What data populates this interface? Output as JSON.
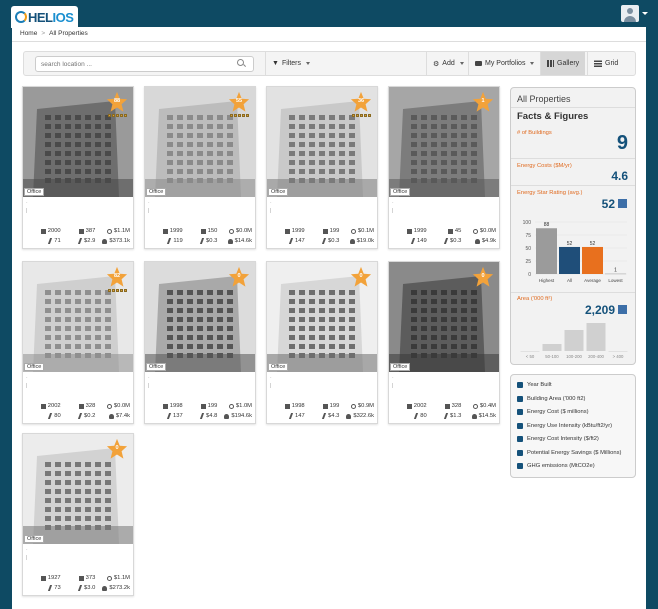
{
  "app": {
    "logo_prefix": "HEL",
    "logo_suffix": "IOS"
  },
  "breadcrumb": {
    "home": "Home",
    "current": "All Properties"
  },
  "toolbar": {
    "search_placeholder": "search location ...",
    "filters_label": "Filters",
    "add_label": "Add",
    "portfolios_label": "My Portfolios",
    "gallery_label": "Gallery",
    "grid_label": "Grid"
  },
  "properties": [
    {
      "stars": "88",
      "type": "Office",
      "year": "2000",
      "area": "387",
      "cost": "$1.1M",
      "eui": "71",
      "ei": "$2.9",
      "savings": "$373.1k",
      "rating_bars": true
    },
    {
      "stars": "55",
      "type": "Office",
      "year": "1999",
      "area": "150",
      "cost": "$0.0M",
      "eui": "119",
      "ei": "$0.3",
      "savings": "$14.6k",
      "rating_bars": true
    },
    {
      "stars": "36",
      "type": "Office",
      "year": "1999",
      "area": "199",
      "cost": "$0.1M",
      "eui": "147",
      "ei": "$0.3",
      "savings": "$19.0k",
      "rating_bars": true
    },
    {
      "stars": "1",
      "type": "Office",
      "year": "1999",
      "area": "45",
      "cost": "$0.0M",
      "eui": "149",
      "ei": "$0.3",
      "savings": "$4.9k",
      "rating_bars": false
    },
    {
      "stars": "82",
      "type": "Office",
      "year": "2002",
      "area": "328",
      "cost": "$0.0M",
      "eui": "80",
      "ei": "$0.2",
      "savings": "$7.4k",
      "rating_bars": true
    },
    {
      "stars": "0",
      "type": "Office",
      "year": "1998",
      "area": "199",
      "cost": "$1.0M",
      "eui": "137",
      "ei": "$4.8",
      "savings": "$194.6k",
      "rating_bars": false
    },
    {
      "stars": "0",
      "type": "Office",
      "year": "1998",
      "area": "199",
      "cost": "$0.9M",
      "eui": "147",
      "ei": "$4.3",
      "savings": "$322.6k",
      "rating_bars": false
    },
    {
      "stars": "0",
      "type": "Office",
      "year": "2002",
      "area": "328",
      "cost": "$0.4M",
      "eui": "80",
      "ei": "$1.3",
      "savings": "$14.5k",
      "rating_bars": false
    },
    {
      "stars": "0",
      "type": "Office",
      "year": "1927",
      "area": "373",
      "cost": "$1.1M",
      "eui": "73",
      "ei": "$3.0",
      "savings": "$273.2k",
      "rating_bars": false
    }
  ],
  "facts": {
    "title": "All Properties",
    "subtitle": "Facts & Figures",
    "buildings_label": "# of Buildings",
    "buildings_value": "9",
    "energy_cost_label": "Energy Costs ($M/yr)",
    "energy_cost_value": "4.6",
    "star_label": "Energy Star Rating (avg.)",
    "star_value": "52",
    "area_label": "Area ('000 ft²)",
    "area_value": "2,209"
  },
  "chart_data": [
    {
      "type": "bar",
      "categories": [
        "Highest",
        "All",
        "Average",
        "Lowest"
      ],
      "values": [
        88,
        52,
        52,
        1
      ],
      "ylim": [
        0,
        100
      ],
      "yticks": [
        "100",
        "75",
        "50",
        "25",
        "0"
      ],
      "colors": [
        "#9b9b9b",
        "#1f4e79",
        "#e8701e",
        "#bdbdbd"
      ]
    },
    {
      "type": "bar",
      "categories": [
        "< 50",
        "50-100",
        "100-200",
        "200-400",
        "> 400"
      ],
      "values": [
        0,
        1,
        3,
        4,
        0
      ],
      "colors": [
        "#d0d0d0",
        "#d0d0d0",
        "#d0d0d0",
        "#d0d0d0",
        "#d0d0d0"
      ]
    }
  ],
  "legend": {
    "items": [
      {
        "label": "Year Built",
        "icon": "calendar-icon"
      },
      {
        "label": "Building Area ('000 ft2)",
        "icon": "area-icon"
      },
      {
        "label": "Energy Cost ($ millions)",
        "icon": "gauge-icon"
      },
      {
        "label": "Energy Use Intensity (kBtu/ft2/yr)",
        "icon": "bolt-icon"
      },
      {
        "label": "Energy Cost Intensity ($/ft2)",
        "icon": "bolt-icon"
      },
      {
        "label": "Potential Energy Savings ($ Millions)",
        "icon": "savings-icon"
      },
      {
        "label": "GHG emissions (MtCO2e)",
        "icon": "leaf-icon"
      }
    ]
  },
  "colors": {
    "brand": "#0e4a63",
    "star": "#f2a23a",
    "accent": "#e06a1f",
    "value": "#14517a"
  }
}
